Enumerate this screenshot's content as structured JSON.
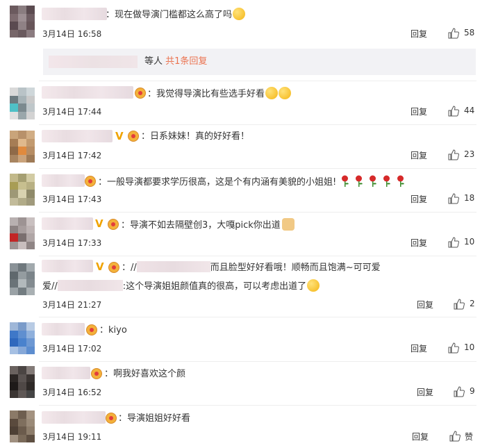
{
  "sub_replies": {
    "suffix": "等人 ",
    "link": "共1条回复"
  },
  "reply_label": "回复",
  "comments": [
    {
      "text": "：现在做导演门槛都这么高了吗",
      "time": "3月14日 16:58",
      "likes": "58"
    },
    {
      "text": "：我觉得导演比有些选手好看",
      "time": "3月14日 17:44",
      "likes": "44"
    },
    {
      "text": "：日系妹妹！真的好好看！",
      "time": "3月14日 17:42",
      "likes": "23"
    },
    {
      "text": "：一般导演都要求学历很高，这是个有内涵有美貌的小姐姐!",
      "time": "3月14日 17:43",
      "likes": "18"
    },
    {
      "text": "：导演不如去隔壁创3，大嘎pick你出道",
      "time": "3月14日 17:33",
      "likes": "10"
    },
    {
      "text_a": "：//",
      "text_b": "而且脸型好好看哦！顺畅而且饱满~可可爱",
      "text_c": "爱//",
      "text_d": ":这个导演姐姐颜值真的很高，可以考虑出道了",
      "time": "3月14日 21:27",
      "likes": "2"
    },
    {
      "text": "：kiyo",
      "time": "3月14日 17:02",
      "likes": "10"
    },
    {
      "text": "：啊我好喜欢这个颜",
      "time": "3月14日 16:52",
      "likes": "9"
    },
    {
      "text": "：导演姐姐好好看",
      "time": "3月14日 19:11",
      "likes": "赞"
    }
  ]
}
